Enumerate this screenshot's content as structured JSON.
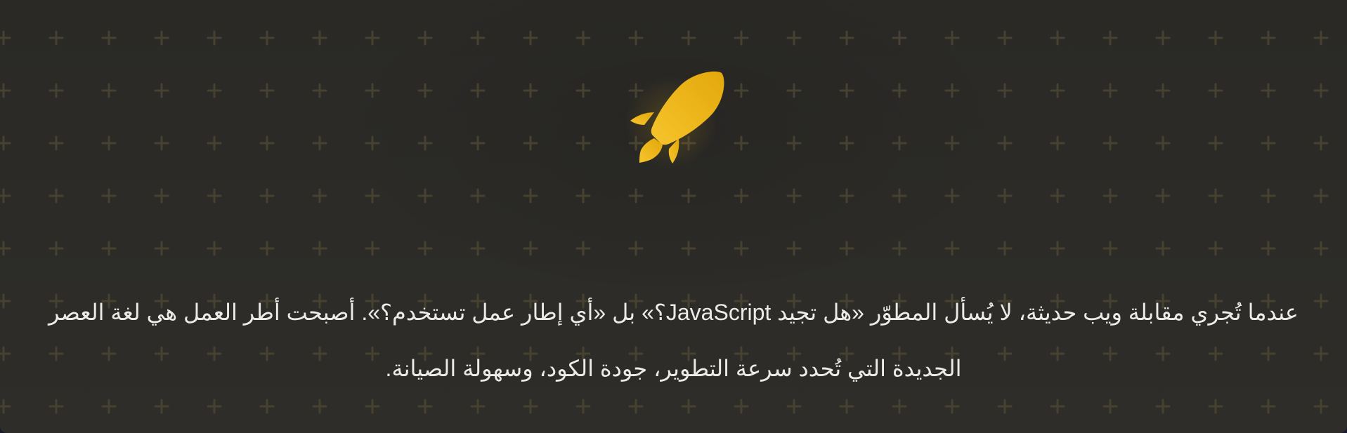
{
  "hero": {
    "icon": "rocket-icon",
    "accent_color": "#f0b81c",
    "background_color": "#2b2a27",
    "text_color": "#ecebe7",
    "description": "عندما تُجري مقابلة ويب حديثة، لا يُسأل المطوّر «هل تجيد JavaScript؟» بل «أي إطار عمل تستخدم؟». أصبحت أطر العمل هي لغة العصر الجديدة التي تُحدد سرعة التطوير، جودة الكود، وسهولة الصيانة."
  }
}
